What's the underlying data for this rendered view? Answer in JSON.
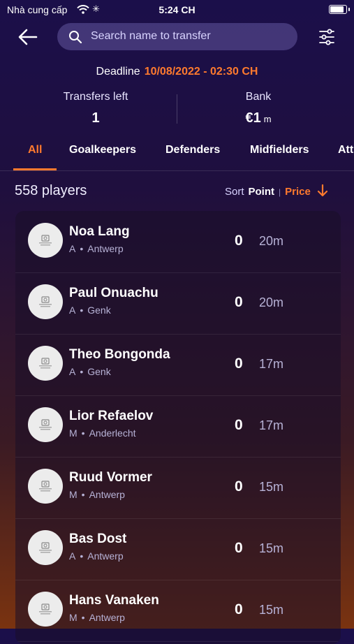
{
  "status_bar": {
    "carrier": "Nhà cung cấp",
    "time": "5:24 CH"
  },
  "search": {
    "placeholder": "Search name to transfer"
  },
  "deadline": {
    "label": "Deadline",
    "value": "10/08/2022 - 02:30 CH"
  },
  "transfers": {
    "label": "Transfers left",
    "value": "1"
  },
  "bank": {
    "label": "Bank",
    "value": "€1",
    "unit": "m"
  },
  "tabs": [
    {
      "label": "All",
      "active": true
    },
    {
      "label": "Goalkeepers"
    },
    {
      "label": "Defenders"
    },
    {
      "label": "Midfielders"
    },
    {
      "label": "Att"
    }
  ],
  "list_header": {
    "count": "558 players",
    "sort_label": "Sort",
    "sort_point": "Point",
    "sort_price": "Price"
  },
  "players": [
    {
      "name": "Noa Lang",
      "position": "A",
      "club": "Antwerp",
      "points": "0",
      "price": "20m"
    },
    {
      "name": "Paul Onuachu",
      "position": "A",
      "club": "Genk",
      "points": "0",
      "price": "20m"
    },
    {
      "name": "Theo Bongonda",
      "position": "A",
      "club": "Genk",
      "points": "0",
      "price": "17m"
    },
    {
      "name": "Lior Refaelov",
      "position": "M",
      "club": "Anderlecht",
      "points": "0",
      "price": "17m"
    },
    {
      "name": "Ruud Vormer",
      "position": "M",
      "club": "Antwerp",
      "points": "0",
      "price": "15m"
    },
    {
      "name": "Bas Dost",
      "position": "A",
      "club": "Antwerp",
      "points": "0",
      "price": "15m"
    },
    {
      "name": "Hans Vanaken",
      "position": "M",
      "club": "Antwerp",
      "points": "0",
      "price": "15m"
    }
  ],
  "colors": {
    "accent": "#ff7a2e",
    "background_top": "#1b0f4a",
    "background_bottom": "#7a3310"
  },
  "icons": {
    "back": "arrow-left-icon",
    "search": "search-icon",
    "filter": "sliders-icon",
    "sort": "arrow-down-icon"
  }
}
